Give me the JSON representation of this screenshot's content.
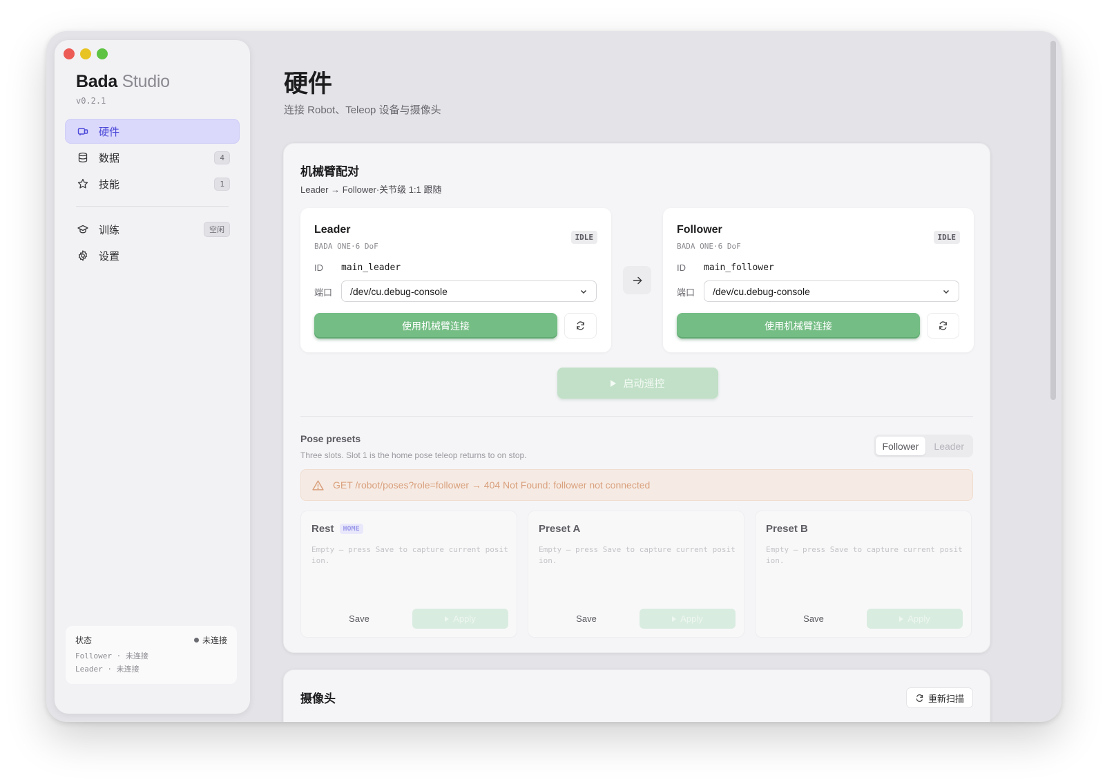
{
  "app": {
    "brand_name": "Bada",
    "brand_suffix": "Studio",
    "version": "v0.2.1"
  },
  "sidebar": {
    "items": [
      {
        "label": "硬件",
        "icon": "hardware-icon",
        "badge": null,
        "active": true
      },
      {
        "label": "数据",
        "icon": "database-icon",
        "badge": "4",
        "active": false
      },
      {
        "label": "技能",
        "icon": "star-icon",
        "badge": "1",
        "active": false
      },
      {
        "label": "训练",
        "icon": "graduation-cap-icon",
        "badge": "空闲",
        "active": false
      },
      {
        "label": "设置",
        "icon": "gear-icon",
        "badge": null,
        "active": false
      }
    ],
    "status": {
      "label": "状态",
      "value": "未连接",
      "follower_line": "Follower · 未连接",
      "leader_line": "Leader · 未连接"
    }
  },
  "page": {
    "title": "硬件",
    "subtitle": "连接 Robot、Teleop 设备与摄像头"
  },
  "pairing": {
    "title": "机械臂配对",
    "subtitle": "Leader → Follower·关节级 1:1 跟随",
    "leader": {
      "name": "Leader",
      "model": "BADA ONE·6 DoF",
      "status": "IDLE",
      "id_label": "ID",
      "id_value": "main_leader",
      "port_label": "端口",
      "port_value": "/dev/cu.debug-console",
      "connect_label": "使用机械臂连接"
    },
    "follower": {
      "name": "Follower",
      "model": "BADA ONE·6 DoF",
      "status": "IDLE",
      "id_label": "ID",
      "id_value": "main_follower",
      "port_label": "端口",
      "port_value": "/dev/cu.debug-console",
      "connect_label": "使用机械臂连接"
    },
    "teleop_label": "启动遥控"
  },
  "poses": {
    "title": "Pose presets",
    "subtitle": "Three slots. Slot 1 is the home pose teleop returns to on stop.",
    "roles": [
      "Follower",
      "Leader"
    ],
    "active_role": "Follower",
    "error": "GET /robot/poses?role=follower → 404 Not Found: follower not connected",
    "presets": [
      {
        "name": "Rest",
        "tag": "HOME",
        "desc": "Empty — press Save to capture current position.",
        "save": "Save",
        "apply": "Apply"
      },
      {
        "name": "Preset A",
        "tag": "",
        "desc": "Empty — press Save to capture current position.",
        "save": "Save",
        "apply": "Apply"
      },
      {
        "name": "Preset B",
        "tag": "",
        "desc": "Empty — press Save to capture current position.",
        "save": "Save",
        "apply": "Apply"
      }
    ]
  },
  "cameras": {
    "title": "摄像头",
    "rescan_label": "重新扫描"
  },
  "colors": {
    "accent": "#4b48d8",
    "accent_bg": "#dad8fb",
    "connect_green": "#74bd84",
    "error_text": "#d9a07d"
  }
}
